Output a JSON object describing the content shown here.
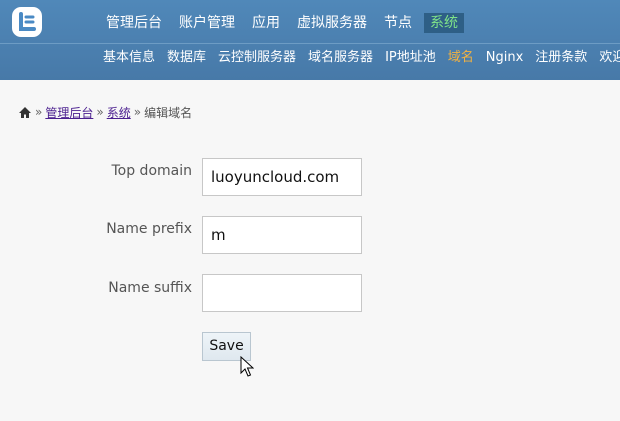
{
  "header": {
    "main_nav": [
      "管理后台",
      "账户管理",
      "应用",
      "虚拟服务器",
      "节点",
      "系统"
    ],
    "active_main": "系统",
    "sub_nav": [
      "基本信息",
      "数据库",
      "云控制服务器",
      "域名服务器",
      "IP地址池",
      "域名",
      "Nginx",
      "注册条款",
      "欢迎新"
    ],
    "active_sub": "域名"
  },
  "breadcrumb": {
    "sep1": "»",
    "link1": "管理后台",
    "sep2": "»",
    "link2": "系统",
    "sep3": "»",
    "current": "编辑域名"
  },
  "form": {
    "top_domain_label": "Top domain",
    "top_domain_value": "luoyuncloud.com",
    "name_prefix_label": "Name prefix",
    "name_prefix_value": "m",
    "name_suffix_label": "Name suffix",
    "name_suffix_value": "",
    "save_label": "Save"
  }
}
